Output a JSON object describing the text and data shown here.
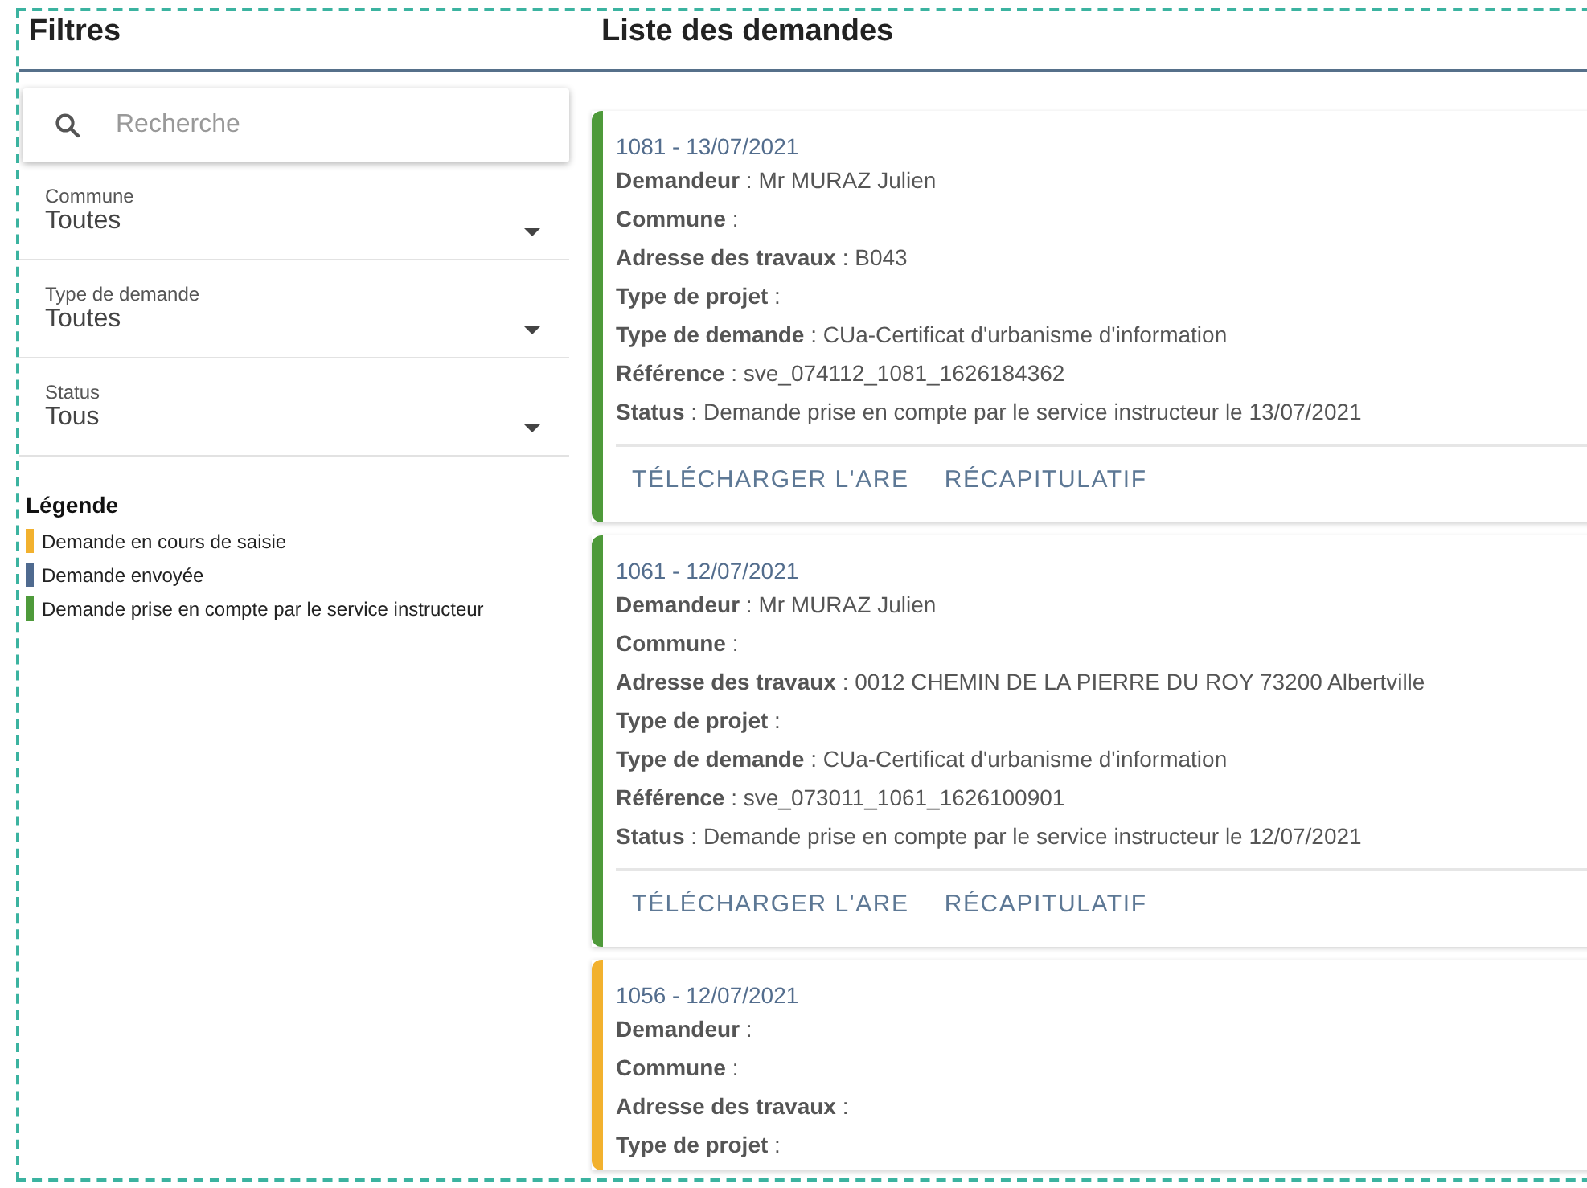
{
  "filters": {
    "title": "Filtres",
    "search": {
      "placeholder": "Recherche"
    },
    "selects": [
      {
        "label": "Commune",
        "value": "Toutes"
      },
      {
        "label": "Type de demande",
        "value": "Toutes"
      },
      {
        "label": "Status",
        "value": "Tous"
      }
    ],
    "legend": {
      "title": "Légende",
      "items": [
        {
          "label": "Demande en cours de saisie",
          "color": "#f2b12e"
        },
        {
          "label": "Demande envoyée",
          "color": "#4f6a8f"
        },
        {
          "label": "Demande prise en compte par le service instructeur",
          "color": "#4e9a3a"
        }
      ]
    }
  },
  "requests": {
    "title": "Liste des demandes",
    "cards": [
      {
        "heading": "1081 - 13/07/2021",
        "color": "#4e9a3a",
        "fields": [
          "**Demandeur** : Mr MURAZ Julien",
          "**Commune** :",
          "**Adresse des travaux** : B043",
          "**Type de projet** :",
          "**Type de demande** : CUa-Certificat d'urbanisme d'information",
          "**Référence** : sve_074112_1081_1626184362",
          "**Status** : Demande prise en compte par le service instructeur le 13/07/2021"
        ],
        "actions": [
          "TÉLÉCHARGER L'ARE",
          "RÉCAPITULATIF"
        ]
      },
      {
        "heading": "1061 - 12/07/2021",
        "color": "#4e9a3a",
        "fields": [
          "**Demandeur** : Mr MURAZ Julien",
          "**Commune** :",
          "**Adresse des travaux** : 0012 CHEMIN DE LA PIERRE DU ROY 73200 Albertville",
          "**Type de projet** :",
          "**Type de demande** : CUa-Certificat d'urbanisme d'information",
          "**Référence** : sve_073011_1061_1626100901",
          "**Status** : Demande prise en compte par le service instructeur le 12/07/2021"
        ],
        "actions": [
          "TÉLÉCHARGER L'ARE",
          "RÉCAPITULATIF"
        ]
      },
      {
        "heading": "1056 - 12/07/2021",
        "color": "#f2b12e",
        "fields": [
          "**Demandeur** :",
          "**Commune** :",
          "**Adresse des travaux** :",
          "**Type de projet** :"
        ]
      }
    ]
  }
}
